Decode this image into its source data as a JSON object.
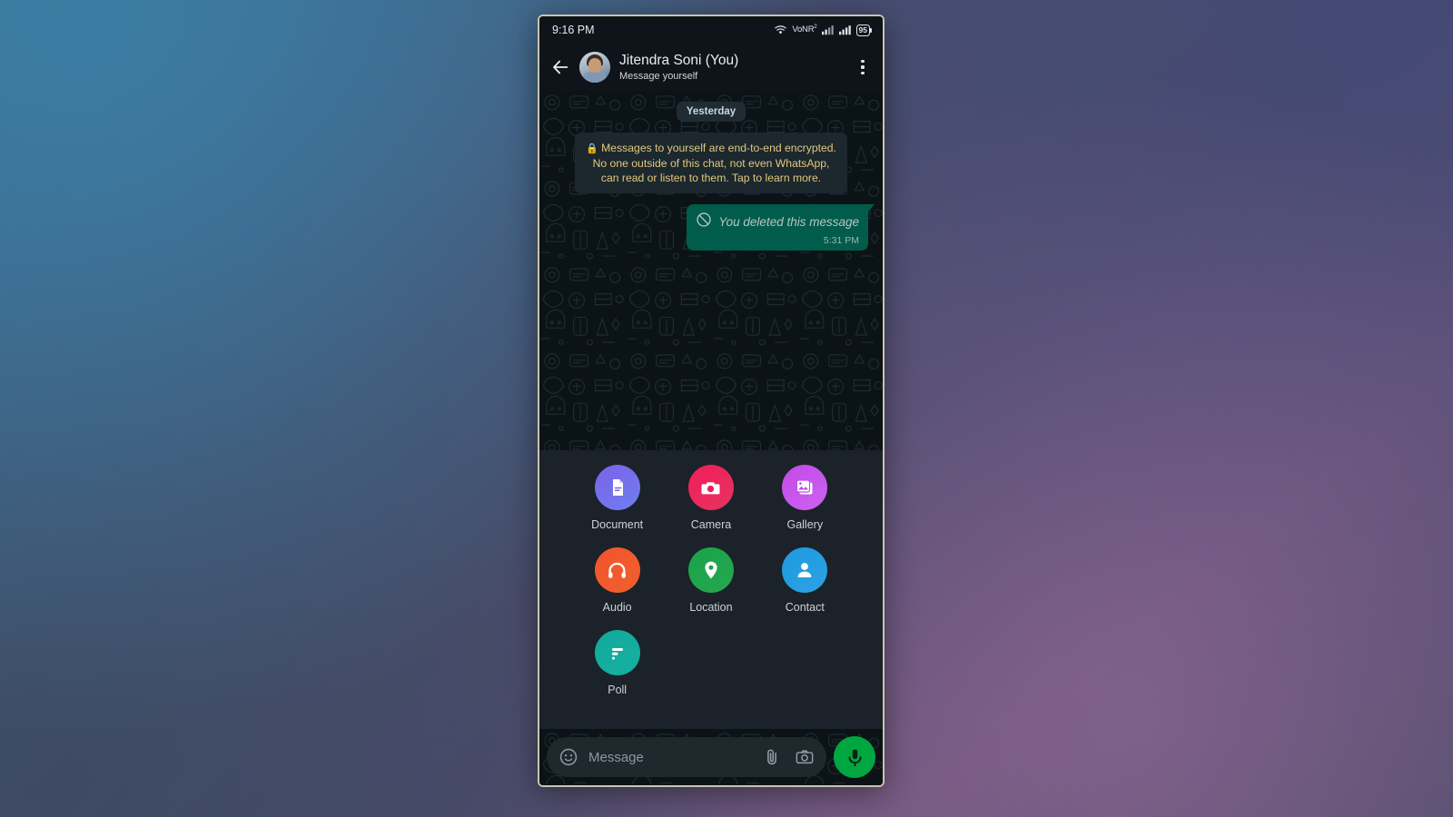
{
  "status_bar": {
    "time": "9:16 PM",
    "wifi_icon": "wifi-icon",
    "volte_label": "VoNR",
    "volte_superscript": "2",
    "signal_icon_1": "signal-bars-icon",
    "signal_icon_2": "signal-bars-icon",
    "battery_level": "95"
  },
  "header": {
    "back_icon": "back-arrow-icon",
    "avatar": "contact-avatar",
    "contact_name": "Jitendra Soni (You)",
    "contact_status": "Message yourself",
    "menu_icon": "overflow-menu-icon"
  },
  "conversation": {
    "date_divider": "Yesterday",
    "encryption_notice": "Messages to yourself are end-to-end encrypted. No one outside of this chat, not even WhatsApp, can read or listen to them. Tap to learn more.",
    "lock_icon": "lock-icon",
    "messages": [
      {
        "text": "You deleted this message",
        "time": "5:31 PM",
        "icon": "blocked-circle-icon",
        "direction": "outgoing"
      }
    ]
  },
  "attachment_panel": {
    "items": [
      {
        "label": "Document",
        "icon": "document-icon",
        "color_start": "#7b61e8",
        "color_end": "#6f7ff0"
      },
      {
        "label": "Camera",
        "icon": "camera-icon",
        "color_start": "#ef1e5a",
        "color_end": "#e8335f"
      },
      {
        "label": "Gallery",
        "icon": "gallery-icon",
        "color_start": "#c24ae8",
        "color_end": "#cc62f0"
      },
      {
        "label": "Audio",
        "icon": "headphones-icon",
        "color_start": "#f2542c",
        "color_end": "#f0602e"
      },
      {
        "label": "Location",
        "icon": "location-pin-icon",
        "color_start": "#1aa349",
        "color_end": "#25a84f"
      },
      {
        "label": "Contact",
        "icon": "person-icon",
        "color_start": "#1f9ae0",
        "color_end": "#2ba2e2"
      },
      {
        "label": "Poll",
        "icon": "poll-bars-icon",
        "color_start": "#12a99a",
        "color_end": "#16b0a2"
      }
    ]
  },
  "input_bar": {
    "emoji_icon": "emoji-smiley-icon",
    "placeholder": "Message",
    "attach_icon": "paperclip-icon",
    "camera_icon": "camera-icon",
    "mic_icon": "microphone-icon",
    "mic_button_color": "#00a63f"
  }
}
